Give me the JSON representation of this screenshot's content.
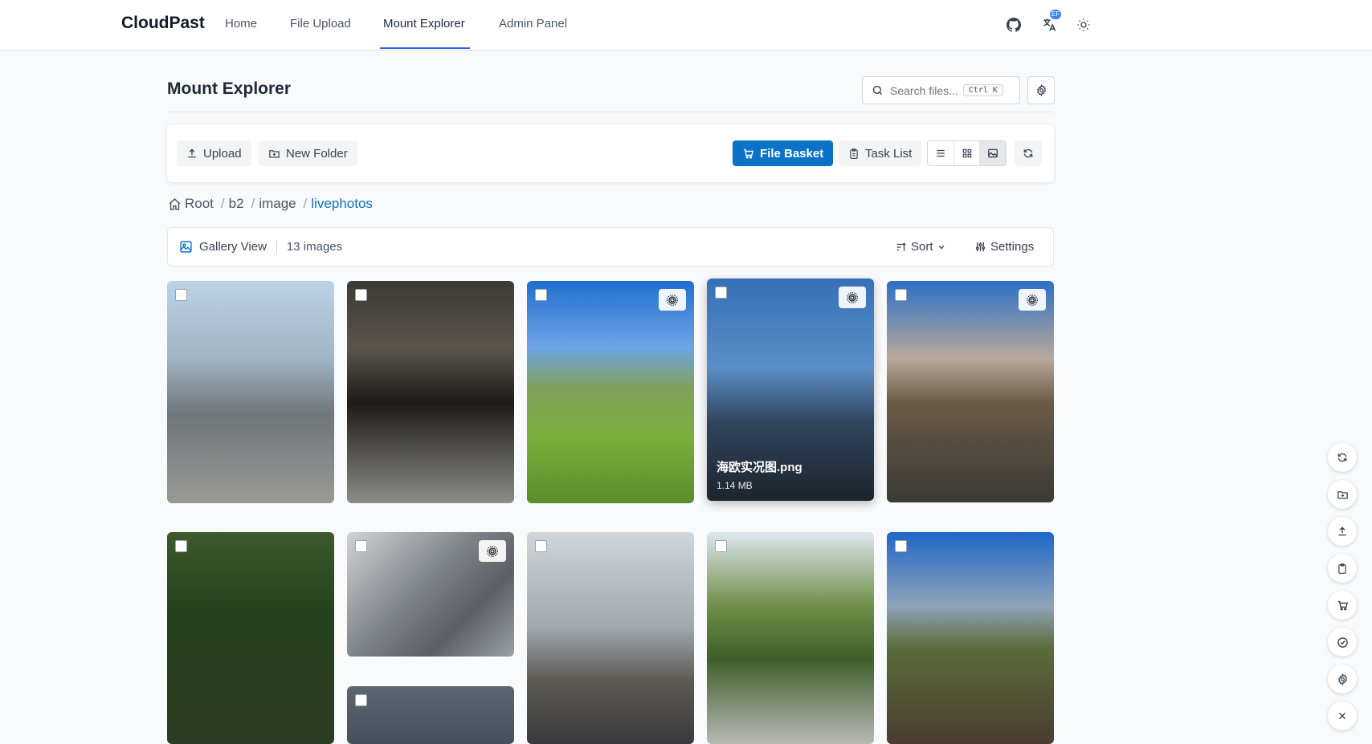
{
  "nav": {
    "brand": "CloudPast",
    "links": [
      "Home",
      "File Upload",
      "Mount Explorer",
      "Admin Panel"
    ],
    "active_index": 2,
    "lang_badge": "EF"
  },
  "header": {
    "title": "Mount Explorer",
    "search_placeholder": "Search files...",
    "search_shortcut": "Ctrl K"
  },
  "toolbar": {
    "upload_label": "Upload",
    "new_folder_label": "New Folder",
    "file_basket_label": "File Basket",
    "task_list_label": "Task List",
    "active_view": "gallery"
  },
  "breadcrumb": {
    "items": [
      "Root",
      "b2",
      "image",
      "livephotos"
    ]
  },
  "gallery": {
    "view_label": "Gallery View",
    "count_label": "13 images",
    "sort_label": "Sort",
    "settings_label": "Settings",
    "items": [
      {
        "live": false,
        "name": "",
        "size": "",
        "hovered": false
      },
      {
        "live": false,
        "name": "",
        "size": "",
        "hovered": false
      },
      {
        "live": true,
        "name": "",
        "size": "",
        "hovered": false
      },
      {
        "live": true,
        "name": "海欧实况图.png",
        "size": "1.14 MB",
        "hovered": true
      },
      {
        "live": true,
        "name": "",
        "size": "",
        "hovered": false
      },
      {
        "live": false,
        "name": "",
        "size": "",
        "hovered": false
      },
      {
        "live": true,
        "name": "",
        "size": "",
        "hovered": false
      },
      {
        "live": false,
        "name": "",
        "size": "",
        "hovered": false
      },
      {
        "live": false,
        "name": "",
        "size": "",
        "hovered": false
      },
      {
        "live": false,
        "name": "",
        "size": "",
        "hovered": false
      },
      {
        "live": false,
        "name": "",
        "size": "",
        "hovered": false
      }
    ]
  },
  "colors": {
    "accent": "#0b72c7",
    "nav_underline": "#2563eb"
  },
  "float_actions": [
    "refresh-icon",
    "new-folder-icon",
    "upload-icon",
    "clipboard-icon",
    "cart-icon",
    "check-circle-icon",
    "gear-icon",
    "close-icon"
  ]
}
